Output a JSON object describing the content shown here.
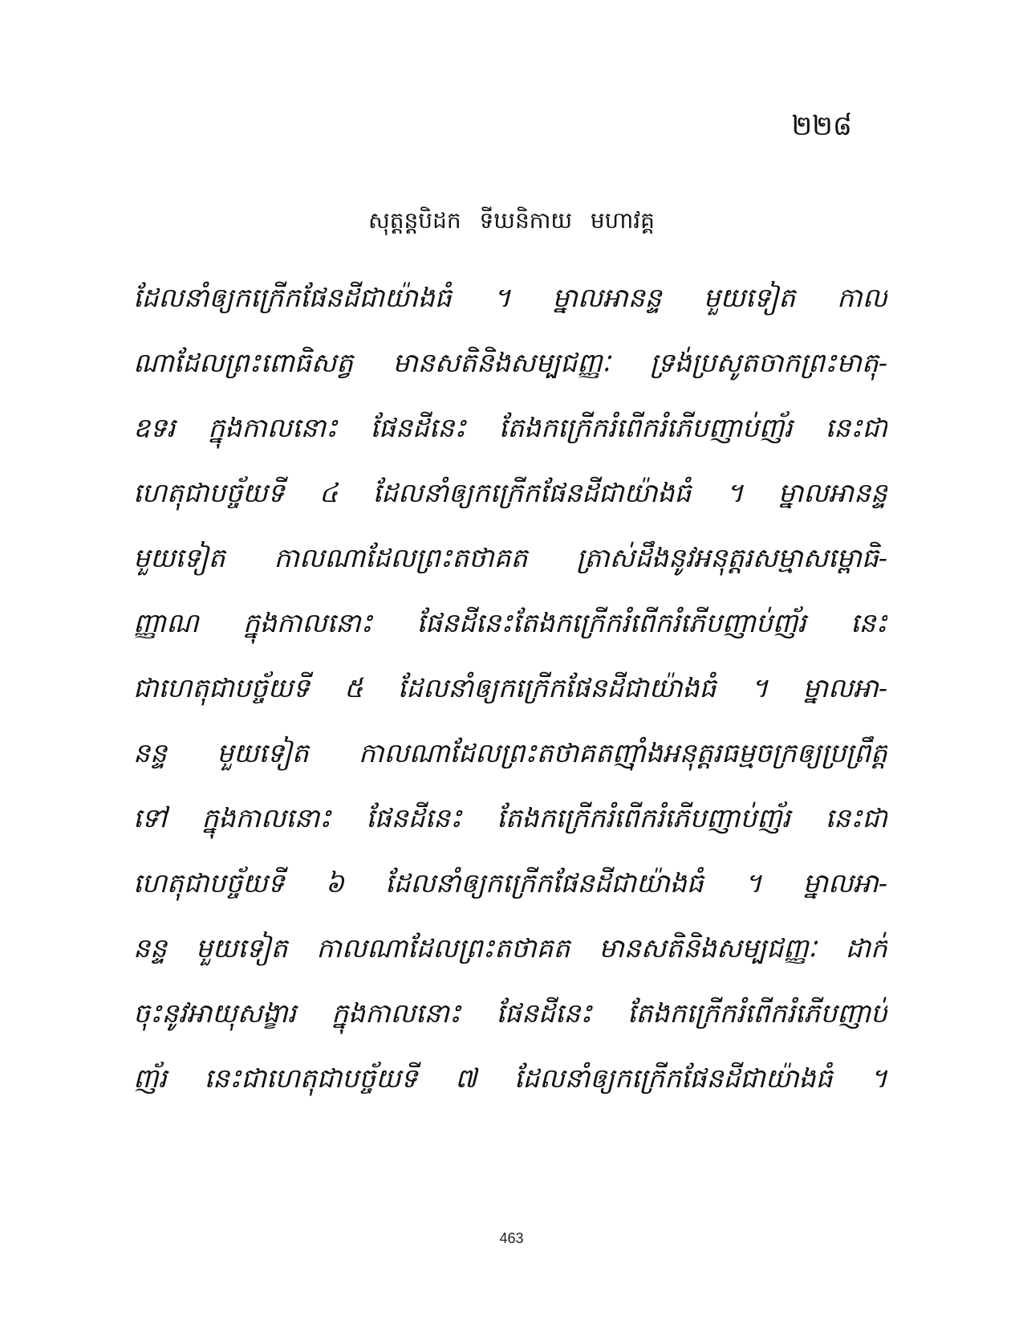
{
  "page": {
    "khmer_page_number": "២២៨",
    "running_header": "សុត្តន្តបិដក ទីឃនិកាយ មហាវគ្គ",
    "footer_page_number": "463"
  },
  "body": {
    "lines": [
      "ដែលនាំឲ្យកក្រើកផែនដីជាយ៉ាងធំ ។ ម្នាលអានន្ទ មួយទៀត កាល",
      "ណាដែលព្រះពោធិសត្វ មានសតិនិងសម្បជញ្ញៈ ទ្រង់ប្រសូតចាកព្រះមាតុ-",
      "ឧទរ ក្នុងកាលនោះ ផែនដីនេះ តែងកក្រើករំពើករំភើបញាប់ញ័រ នេះជា",
      "ហេតុជាបច្ច័យទី ៤ ដែលនាំឲ្យកក្រើកផែនដីជាយ៉ាងធំ ។ ម្នាលអានន្ទ",
      "មួយទៀត កាលណាដែលព្រះតថាគត ត្រាស់ដឹងនូវអនុត្តរសម្មាសម្ពោធិ-",
      "ញ្ញាណ ក្នុងកាលនោះ ផែនដីនេះតែងកក្រើករំពើករំភើបញាប់ញ័រ នេះ",
      "ជាហេតុជាបច្ច័យទី ៥ ដែលនាំឲ្យកក្រើកផែនដីជាយ៉ាងធំ ។ ម្នាលអា-",
      "នន្ទ មួយទៀត កាលណាដែលព្រះតថាគតញ៉ាំងអនុត្តរធម្មចក្រឲ្យប្រព្រឹត្ត",
      "ទៅ ក្នុងកាលនោះ ផែនដីនេះ តែងកក្រើករំពើករំភើបញាប់ញ័រ នេះជា",
      "ហេតុជាបច្ច័យទី ៦ ដែលនាំឲ្យកក្រើកផែនដីជាយ៉ាងធំ ។ ម្នាលអា-",
      "នន្ទ មួយទៀត កាលណាដែលព្រះតថាគត មានសតិនិងសម្បជញ្ញៈ ដាក់",
      "ចុះនូវអាយុសង្ខារ ក្នុងកាលនោះ ផែនដីនេះ តែងកក្រើករំពើករំភើបញាប់",
      "ញ័រ នេះជាហេតុជាបច្ច័យទី ៧ ដែលនាំឲ្យកក្រើកផែនដីជាយ៉ាងធំ ។"
    ]
  }
}
